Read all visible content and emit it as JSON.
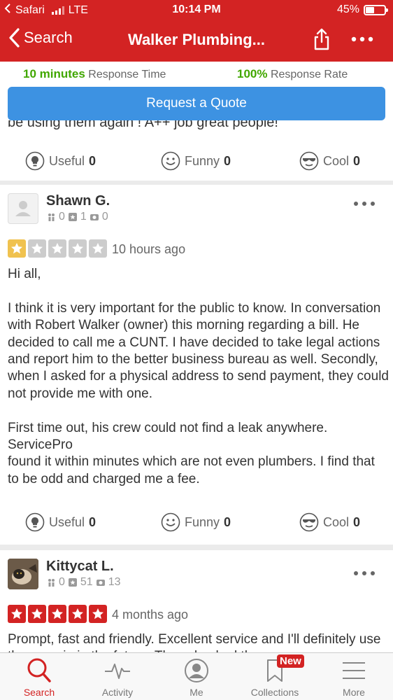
{
  "status_bar": {
    "carrier": "Safari",
    "network": "LTE",
    "time": "10:14 PM",
    "battery": "45%",
    "battery_level": 0.45
  },
  "nav": {
    "back_label": "Search",
    "title": "Walker Plumbing..."
  },
  "response": {
    "time_value": "10 minutes",
    "time_label": "Response Time",
    "rate_value": "100%",
    "rate_label": "Response Rate"
  },
  "quote_button": "Request a Quote",
  "previous_review": {
    "text_tail": "be using them again ! A++ job great people!",
    "useful_label": "Useful",
    "useful_count": "0",
    "funny_label": "Funny",
    "funny_count": "0",
    "cool_label": "Cool",
    "cool_count": "0"
  },
  "reviews": [
    {
      "name": "Shawn G.",
      "friends": "0",
      "reviews": "1",
      "photos": "0",
      "rating": 1,
      "date": "10 hours ago",
      "text": "Hi all,\n\nI think it is very important for the public to know. In conversation with Robert Walker (owner) this morning regarding a bill. He decided to call me a CUNT. I have decided to take legal actions and report him to the better business bureau as well. Secondly, when I asked for a physical address to send payment, they could not provide me with one.\n\nFirst time out, his crew could not find a leak anywhere. ServicePro\nfound it within minutes which are not even plumbers. I find that to be odd and charged me a fee.",
      "useful_label": "Useful",
      "useful_count": "0",
      "funny_label": "Funny",
      "funny_count": "0",
      "cool_label": "Cool",
      "cool_count": "0"
    },
    {
      "name": "Kittycat L.",
      "friends": "0",
      "reviews": "51",
      "photos": "13",
      "rating": 5,
      "date": "4 months ago",
      "text": "Prompt, fast and friendly. Excellent service and I'll definitely use them again in the future. They checked th"
    }
  ],
  "tabbar": {
    "search": "Search",
    "activity": "Activity",
    "me": "Me",
    "collections": "Collections",
    "more": "More",
    "new_badge": "New"
  },
  "colors": {
    "brand_red": "#d32323",
    "quote_blue": "#3d92e2",
    "green": "#41a700",
    "star_one": "#f0c24f",
    "star_five": "#d32323",
    "star_empty": "#cccccc"
  }
}
